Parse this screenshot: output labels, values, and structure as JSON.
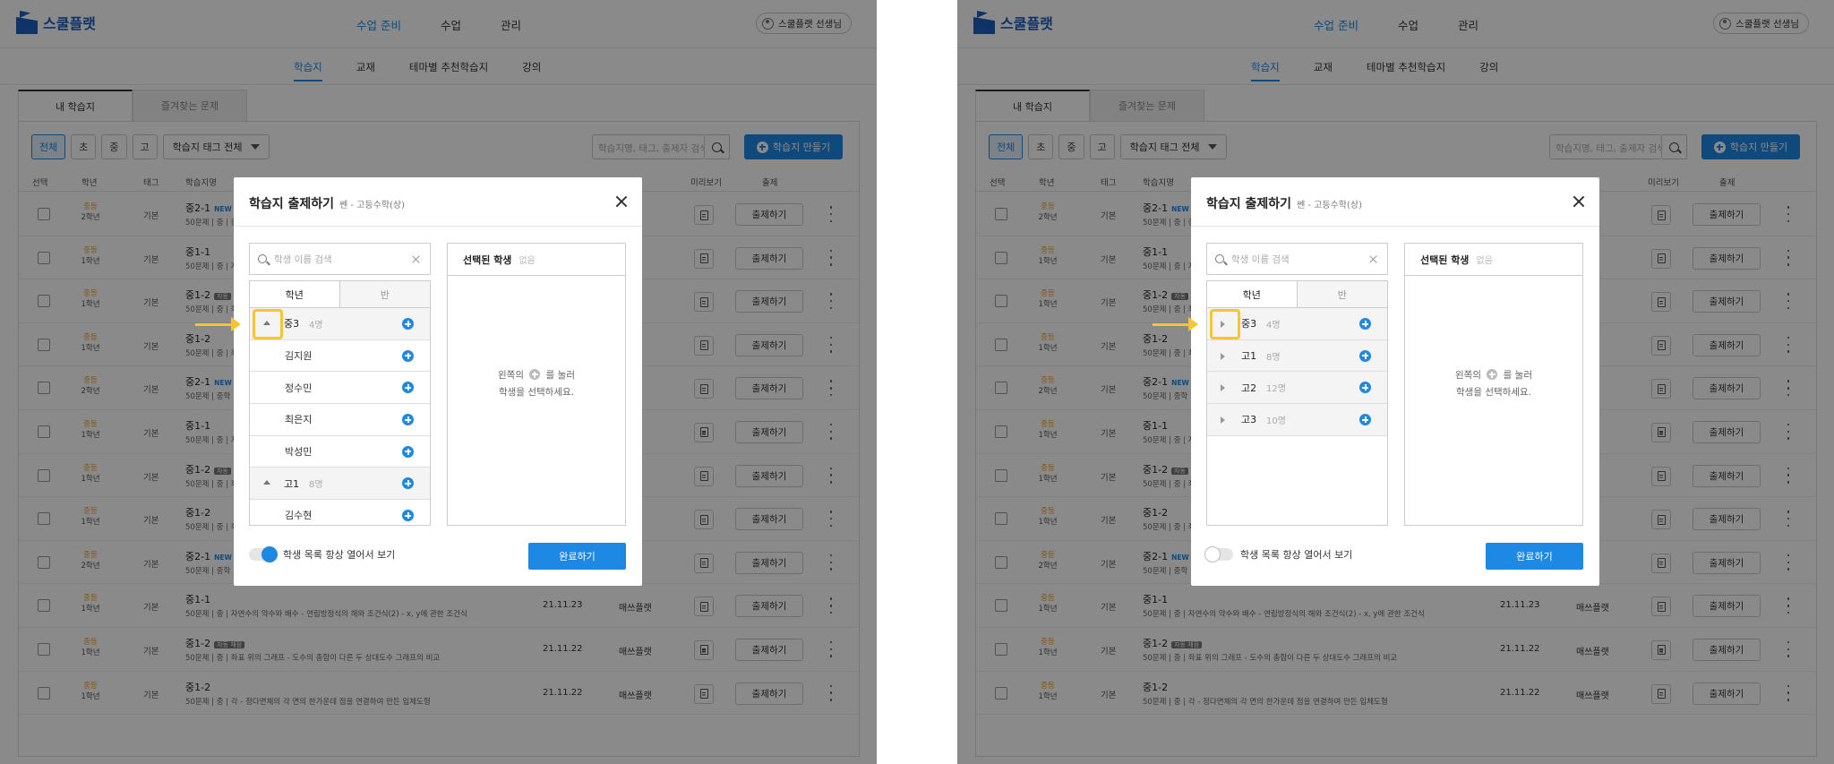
{
  "app": {
    "logo_text": "스쿨플랫",
    "nav": [
      "수업 준비",
      "수업",
      "관리"
    ],
    "user": "스쿨플랫 선생님",
    "subnav": [
      "학습지",
      "교재",
      "테마별 추천학습지",
      "강의"
    ],
    "tabs": [
      "내 학습지",
      "즐겨찾는 문제"
    ],
    "filters": [
      "전체",
      "초",
      "중",
      "고"
    ],
    "tag_filter": "학습지 태그 전체",
    "search_placeholder": "학습지명, 태그, 출제자 검색",
    "create_button": "학습지 만들기",
    "columns": [
      "선택",
      "학년",
      "태그",
      "학습지명",
      "미리보기",
      "출제"
    ],
    "assign_label": "출제하기",
    "rows": [
      {
        "level": "중등",
        "year": "2학년",
        "tag": "기본",
        "title": "중2-1",
        "badge": "NEW",
        "badge_type": "new",
        "desc": "50문제 | 중 | 중학",
        "date": "",
        "maker": ""
      },
      {
        "level": "중등",
        "year": "1학년",
        "tag": "기본",
        "title": "중1-1",
        "badge": "",
        "badge_type": "",
        "desc": "50문제 | 중 | 자",
        "date": "",
        "maker": ""
      },
      {
        "level": "중등",
        "year": "1학년",
        "tag": "기본",
        "title": "중1-2",
        "badge": "자동",
        "badge_type": "grey",
        "desc": "50문제 | 중 | 좌",
        "date": "",
        "maker": ""
      },
      {
        "level": "중등",
        "year": "1학년",
        "tag": "기본",
        "title": "중1-2",
        "badge": "",
        "badge_type": "",
        "desc": "50문제 | 중 | 좌",
        "date": "",
        "maker": ""
      },
      {
        "level": "중등",
        "year": "2학년",
        "tag": "기본",
        "title": "중2-1",
        "badge": "NEW",
        "badge_type": "new",
        "desc": "50문제 | 중학",
        "date": "",
        "maker": ""
      },
      {
        "level": "중등",
        "year": "1학년",
        "tag": "기본",
        "title": "중1-1",
        "badge": "",
        "badge_type": "",
        "desc": "50문제 | 중 | 자",
        "date": "",
        "maker": ""
      },
      {
        "level": "중등",
        "year": "1학년",
        "tag": "기본",
        "title": "중1-2",
        "badge": "자동",
        "badge_type": "grey",
        "desc": "50문제 | 중 | 좌",
        "date": "",
        "maker": ""
      },
      {
        "level": "중등",
        "year": "1학년",
        "tag": "기본",
        "title": "중1-2",
        "badge": "",
        "badge_type": "",
        "desc": "50문제 | 중 | 좌",
        "date": "",
        "maker": ""
      },
      {
        "level": "중등",
        "year": "2학년",
        "tag": "기본",
        "title": "중2-1",
        "badge": "NEW",
        "badge_type": "new",
        "desc": "50문제 | 중학",
        "date": "",
        "maker": ""
      },
      {
        "level": "중등",
        "year": "1학년",
        "tag": "기본",
        "title": "중1-1",
        "badge": "",
        "badge_type": "",
        "desc": "50문제 | 중 | 자연수의 약수와 배수 - 연립방정식의 해와 조건식(2) - x, y에 관한 조건식",
        "date": "21.11.23",
        "maker": "매쓰플랫"
      },
      {
        "level": "중등",
        "year": "1학년",
        "tag": "기본",
        "title": "중1-2",
        "badge": "자동 채점",
        "badge_type": "grey",
        "desc": "50문제 | 중 | 좌표 위의 그래프 - 도수의 총합이 다른 두 상대도수 그래프의 비교",
        "date": "21.11.22",
        "maker": "매쓰플랫"
      },
      {
        "level": "중등",
        "year": "1학년",
        "tag": "기본",
        "title": "중1-2",
        "badge": "",
        "badge_type": "",
        "desc": "50문제 | 중 | 각 - 정다면체의 각 면의 한가운데 점을 연결하여 만든 입체도형",
        "date": "21.11.22",
        "maker": "매쓰플랫"
      }
    ]
  },
  "modal": {
    "title": "학습지 출제하기",
    "subtitle": "쎈 - 고등수학(상)",
    "search_placeholder": "학생 이름 검색",
    "tabs": [
      "학년",
      "반"
    ],
    "selected_label": "선택된 학생",
    "selected_none": "없음",
    "empty_line1_a": "왼쪽의",
    "empty_line1_b": "를 눌러",
    "empty_line2": "학생을 선택하세요.",
    "toggle_label": "학생 목록 항상 열어서 보기",
    "done_button": "완료하기"
  },
  "state_a": {
    "toggle_on": true,
    "list": [
      {
        "type": "group",
        "name": "중3",
        "count": "4명",
        "expanded": true
      },
      {
        "type": "student",
        "name": "김지원"
      },
      {
        "type": "student",
        "name": "정수민"
      },
      {
        "type": "student",
        "name": "최은지"
      },
      {
        "type": "student",
        "name": "박성민"
      },
      {
        "type": "group",
        "name": "고1",
        "count": "8명",
        "expanded": true
      },
      {
        "type": "student",
        "name": "김수현"
      }
    ]
  },
  "state_b": {
    "toggle_on": false,
    "list": [
      {
        "type": "group",
        "name": "중3",
        "count": "4명",
        "expanded": false
      },
      {
        "type": "group",
        "name": "고1",
        "count": "8명",
        "expanded": false
      },
      {
        "type": "group",
        "name": "고2",
        "count": "12명",
        "expanded": false
      },
      {
        "type": "group",
        "name": "고3",
        "count": "10명",
        "expanded": false
      }
    ]
  },
  "colors": {
    "accent": "#1e88e5",
    "highlight": "#f7c531",
    "level": "#f0a030"
  }
}
